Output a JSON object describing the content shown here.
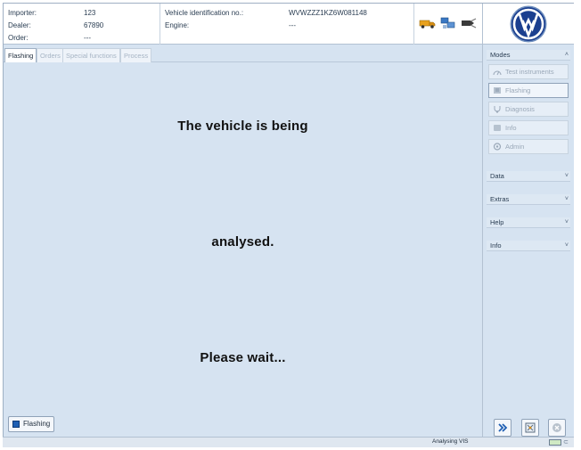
{
  "header": {
    "importer_label": "Importer:",
    "importer_value": "123",
    "dealer_label": "Dealer:",
    "dealer_value": "67890",
    "order_label": "Order:",
    "order_value": "---",
    "vin_label": "Vehicle identification no.:",
    "vin_value": "WVWZZZ1KZ6W081148",
    "engine_label": "Engine:",
    "engine_value": "---",
    "icons": [
      "truck-icon",
      "network-computer-icon",
      "connector-plug-icon"
    ]
  },
  "logo": "vw-logo",
  "tabs": [
    {
      "label": "Flashing",
      "active": true
    },
    {
      "label": "Orders",
      "active": false
    },
    {
      "label": "Special functions",
      "active": false
    },
    {
      "label": "Process",
      "active": false
    }
  ],
  "main": {
    "line1": "The vehicle is being",
    "line2": "analysed.",
    "line3": "Please wait..."
  },
  "bottom_button": {
    "label": "Flashing"
  },
  "right_panel": {
    "modes_label": "Modes",
    "modes": [
      {
        "label": "Test instruments",
        "icon": "gauge-icon"
      },
      {
        "label": "Flashing",
        "icon": "flash-chip-icon"
      },
      {
        "label": "Diagnosis",
        "icon": "stethoscope-icon"
      },
      {
        "label": "Info",
        "icon": "info-icon"
      },
      {
        "label": "Admin",
        "icon": "admin-gear-icon"
      }
    ],
    "data_label": "Data",
    "extras_label": "Extras",
    "help_label": "Help",
    "info_label": "Info",
    "chevron_up": "˄",
    "chevron_down": "˅"
  },
  "status_bar": {
    "text": "Analysing VIS"
  },
  "colors": {
    "background": "#d6e3f1",
    "accent_blue": "#1f5fb3",
    "vw_blue": "#1b3f8f"
  }
}
